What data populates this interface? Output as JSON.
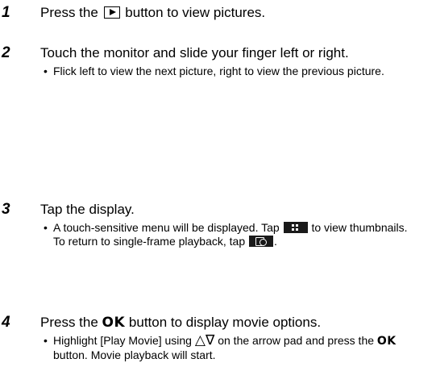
{
  "steps": [
    {
      "number": "1",
      "text_before": "Press the",
      "icon": "play-icon",
      "text_after": "button to view pictures."
    },
    {
      "number": "2",
      "text": "Touch the monitor and slide your finger left or right.",
      "bullet": "Flick left to view the next picture, right to view the previous picture."
    },
    {
      "number": "3",
      "text": "Tap the display.",
      "bullet_part1": "A touch-sensitive menu will be displayed. Tap",
      "bullet_icon1": "thumbnail-icon",
      "bullet_part2": "to view thumbnails. To return to single-frame playback, tap",
      "bullet_icon2": "single-frame-zoom-icon",
      "bullet_part3": "."
    },
    {
      "number": "4",
      "text_before": "Press the",
      "ok_label": "OK",
      "text_after": "button to display movie options.",
      "bullet_part1": "Highlight [Play Movie] using",
      "arrow_symbols": "△∇",
      "bullet_part2": "on the arrow pad and press the",
      "bullet_ok": "OK",
      "bullet_part3": "button. Movie playback will start."
    }
  ]
}
